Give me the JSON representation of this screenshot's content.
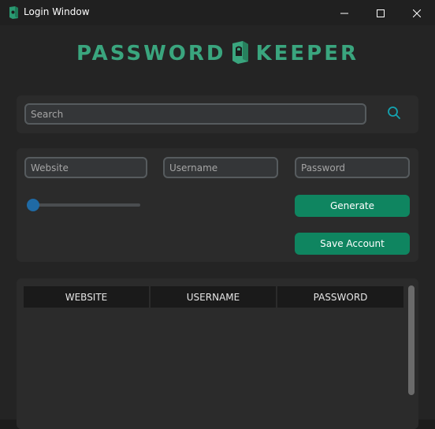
{
  "window": {
    "title": "Login Window"
  },
  "logo": {
    "left_word": "PASSWORD",
    "right_word": "KEEPER",
    "color": "#3aa57e"
  },
  "search": {
    "placeholder": "Search",
    "value": ""
  },
  "form": {
    "website_placeholder": "Website",
    "username_placeholder": "Username",
    "password_placeholder": "Password",
    "length_slider_fraction": 0.0,
    "generate_label": "Generate",
    "save_label": "Save Account"
  },
  "table": {
    "columns": [
      "WEBSITE",
      "USERNAME",
      "PASSWORD"
    ],
    "rows": []
  },
  "colors": {
    "accent_button": "#0f8560",
    "slider": "#1f6aa5",
    "search_icon": "#14a3b0"
  },
  "icons": [
    "app-lock-icon",
    "minimize-icon",
    "maximize-icon",
    "close-icon",
    "lock-logo-icon",
    "search-icon"
  ]
}
